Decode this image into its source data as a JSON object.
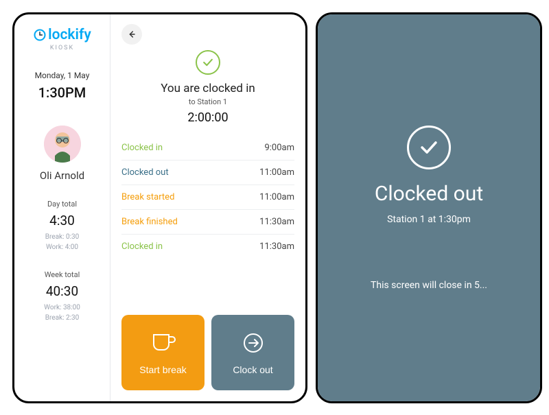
{
  "brand": {
    "name": "lockify",
    "kiosk": "KIOSK"
  },
  "sidebar": {
    "date": "Monday, 1 May",
    "time": "1:30PM",
    "user_name": "Oli Arnold",
    "day_total_label": "Day total",
    "day_total_value": "4:30",
    "day_total_break": "Break: 0:30",
    "day_total_work": "Work: 4:00",
    "week_total_label": "Week total",
    "week_total_value": "40:30",
    "week_total_work": "Work: 38:00",
    "week_total_break": "Break: 2:30"
  },
  "main": {
    "status_title": "You are clocked in",
    "status_sub": "to Station 1",
    "timer": "2:00:00",
    "log": [
      {
        "label": "Clocked in",
        "time": "9:00am",
        "cls": "lbl-green"
      },
      {
        "label": "Clocked out",
        "time": "11:00am",
        "cls": "lbl-blue"
      },
      {
        "label": "Break started",
        "time": "11:00am",
        "cls": "lbl-orange"
      },
      {
        "label": "Break finished",
        "time": "11:30am",
        "cls": "lbl-orange"
      },
      {
        "label": "Clocked in",
        "time": "11:30am",
        "cls": "lbl-green"
      }
    ],
    "start_break_label": "Start break",
    "clock_out_label": "Clock out"
  },
  "confirm": {
    "title": "Clocked out",
    "sub": "Station 1 at 1:30pm",
    "countdown": "This screen will close in 5..."
  }
}
